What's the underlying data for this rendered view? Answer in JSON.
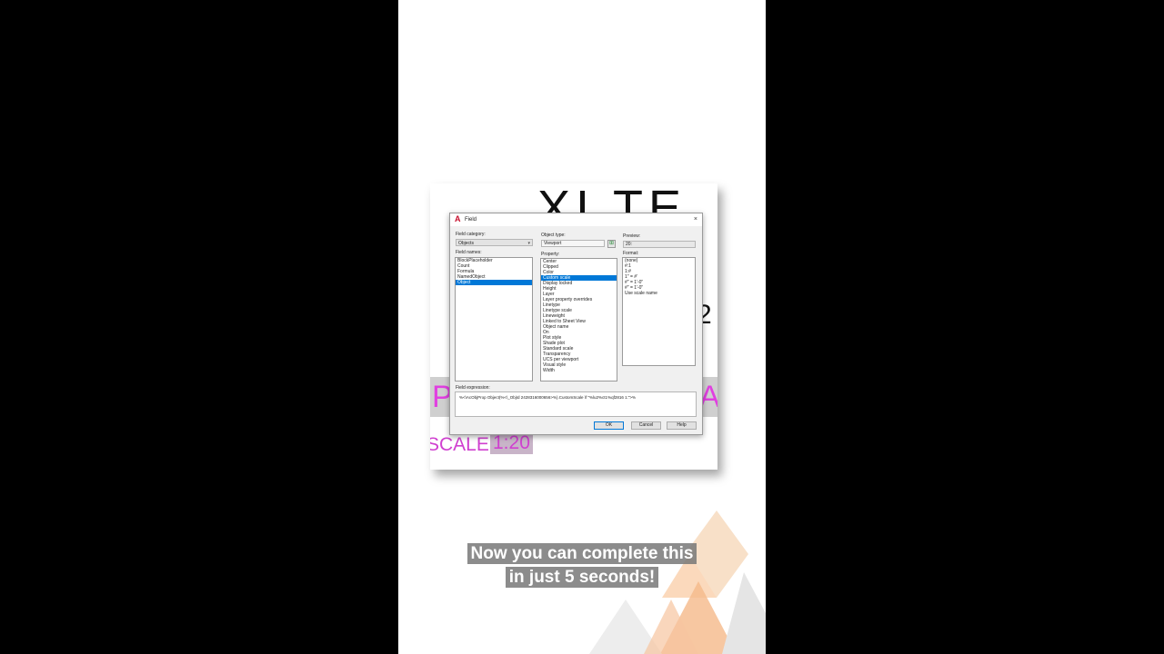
{
  "background_drawing": {
    "title_text": "XI TE",
    "two_text": "2",
    "band_left_text": "P",
    "band_right_text": "A",
    "scale_label": "SCALE:",
    "scale_value": "1:20"
  },
  "dialog": {
    "title": "Field",
    "close_glyph": "×",
    "field_category_label": "Field category:",
    "field_category_value": "Objects",
    "field_names_label": "Field names:",
    "field_names": [
      "BlockPlaceholder",
      "Count",
      "Formula",
      "NamedObject",
      "Object"
    ],
    "field_names_selected": "Object",
    "object_type_label": "Object type:",
    "object_type_value": "Viewport",
    "property_label": "Property:",
    "properties": [
      "Center",
      "Clipped",
      "Color",
      "Custom scale",
      "Display locked",
      "Height",
      "Layer",
      "Layer property overrides",
      "Linetype",
      "Linetype scale",
      "Lineweight",
      "Linked to Sheet View",
      "Object name",
      "On",
      "Plot style",
      "Shade plot",
      "Standard scale",
      "Transparency",
      "UCS per viewport",
      "Visual style",
      "Width"
    ],
    "property_selected": "Custom scale",
    "preview_label": "Preview:",
    "preview_value": "20:",
    "format_label": "Format:",
    "formats": [
      "(none)",
      "#:1",
      "1:#",
      "1\" = #'",
      "#\" = 1'-0\"",
      "#\" = 1'-0\"",
      "Use scale name"
    ],
    "field_expression_label": "Field expression:",
    "field_expression": "%<\\AcObjProp Object(%<\\_ObjId 2428316000656>%).CustomScale \\f \"%lu2%ct1%qf2816 1:\">%",
    "ok_label": "OK",
    "cancel_label": "Cancel",
    "help_label": "Help"
  },
  "caption": {
    "line1": "Now you can complete this",
    "line2": "in just 5 seconds!"
  },
  "colors": {
    "accent_magenta": "#e040e0",
    "selection_blue": "#0078d7",
    "deco_orange": "#f5b98a"
  }
}
